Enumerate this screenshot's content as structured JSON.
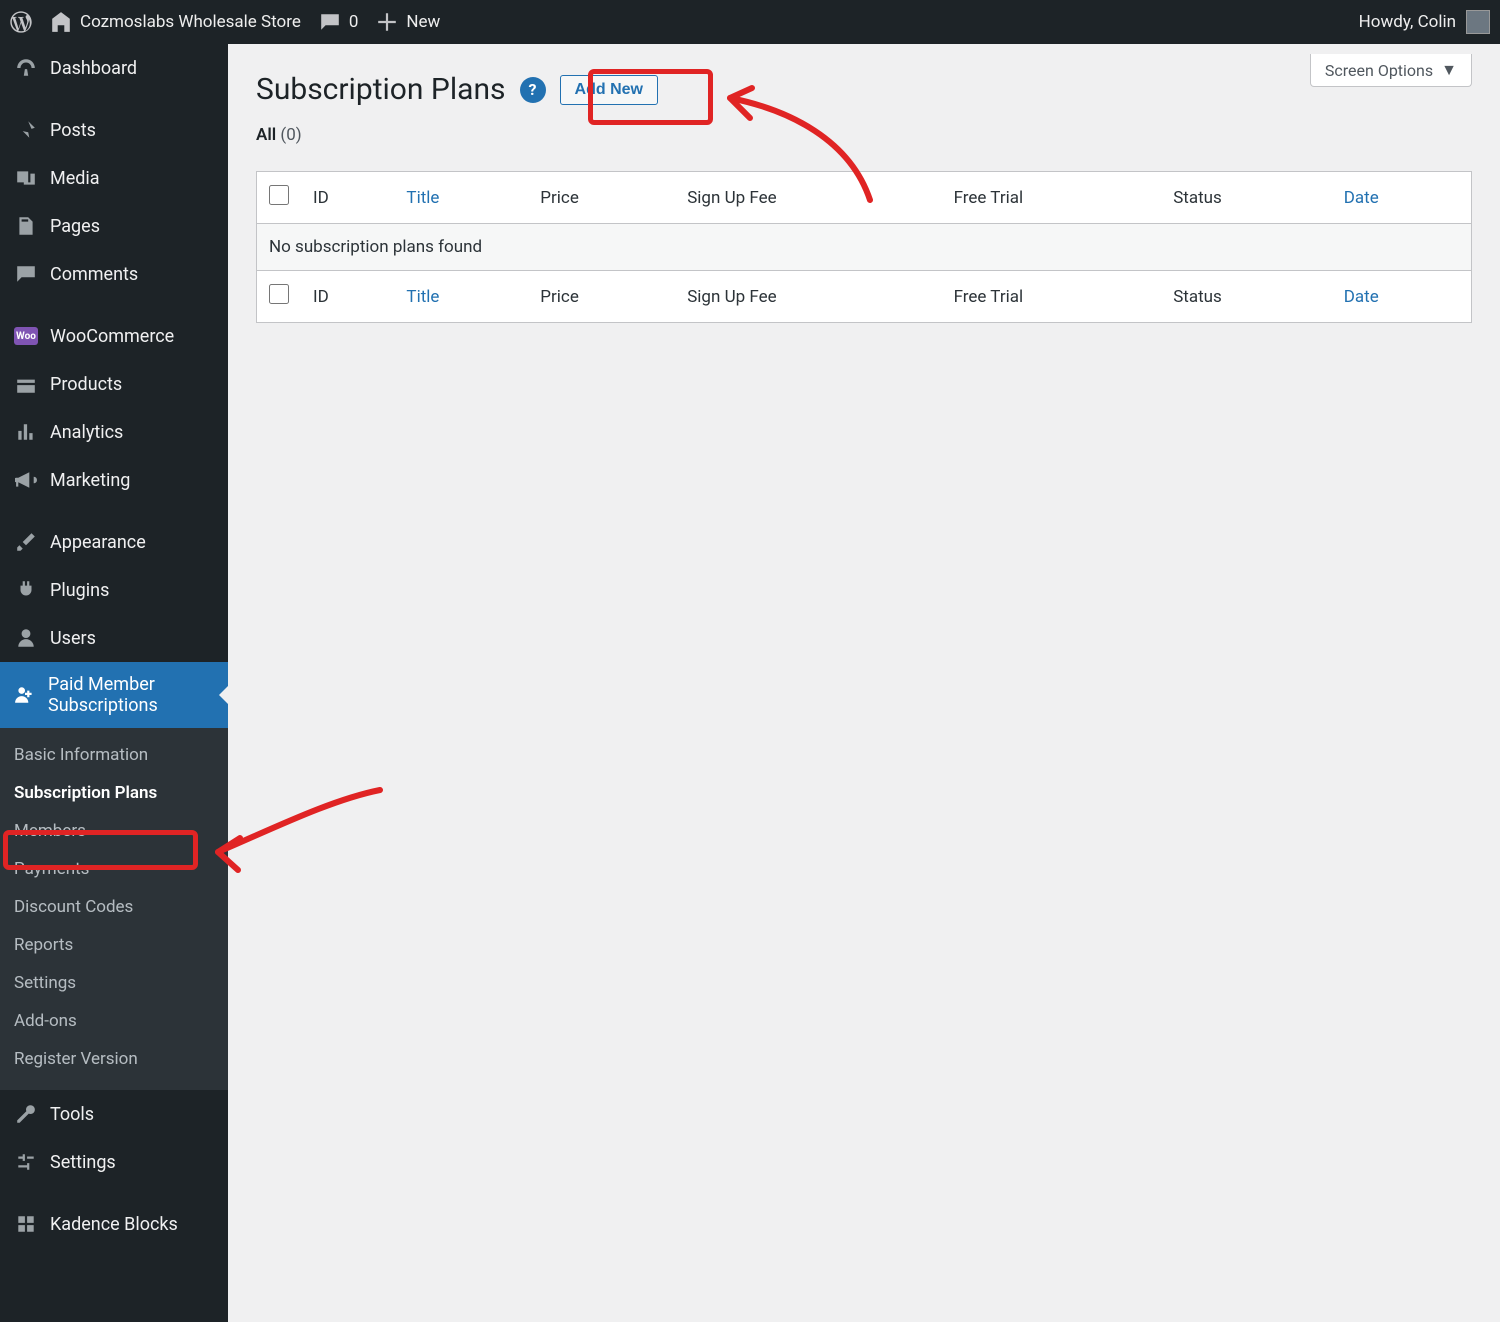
{
  "adminbar": {
    "site_name": "Cozmoslabs Wholesale Store",
    "comments_count": "0",
    "new_label": "New",
    "howdy": "Howdy, Colin"
  },
  "menu": {
    "dashboard": "Dashboard",
    "posts": "Posts",
    "media": "Media",
    "pages": "Pages",
    "comments": "Comments",
    "woocommerce": "WooCommerce",
    "products": "Products",
    "analytics": "Analytics",
    "marketing": "Marketing",
    "appearance": "Appearance",
    "plugins": "Plugins",
    "users": "Users",
    "pms": "Paid Member Subscriptions",
    "tools": "Tools",
    "settings": "Settings",
    "kadence": "Kadence Blocks"
  },
  "submenu": {
    "items": [
      "Basic Information",
      "Subscription Plans",
      "Members",
      "Payments",
      "Discount Codes",
      "Reports",
      "Settings",
      "Add-ons",
      "Register Version"
    ],
    "current_index": 1
  },
  "page": {
    "title": "Subscription Plans",
    "add_new": "Add New",
    "screen_options": "Screen Options",
    "filter_all": "All",
    "filter_count": "(0)",
    "no_items": "No subscription plans found"
  },
  "columns": {
    "id": "ID",
    "title": "Title",
    "price": "Price",
    "signup": "Sign Up Fee",
    "trial": "Free Trial",
    "status": "Status",
    "date": "Date"
  }
}
